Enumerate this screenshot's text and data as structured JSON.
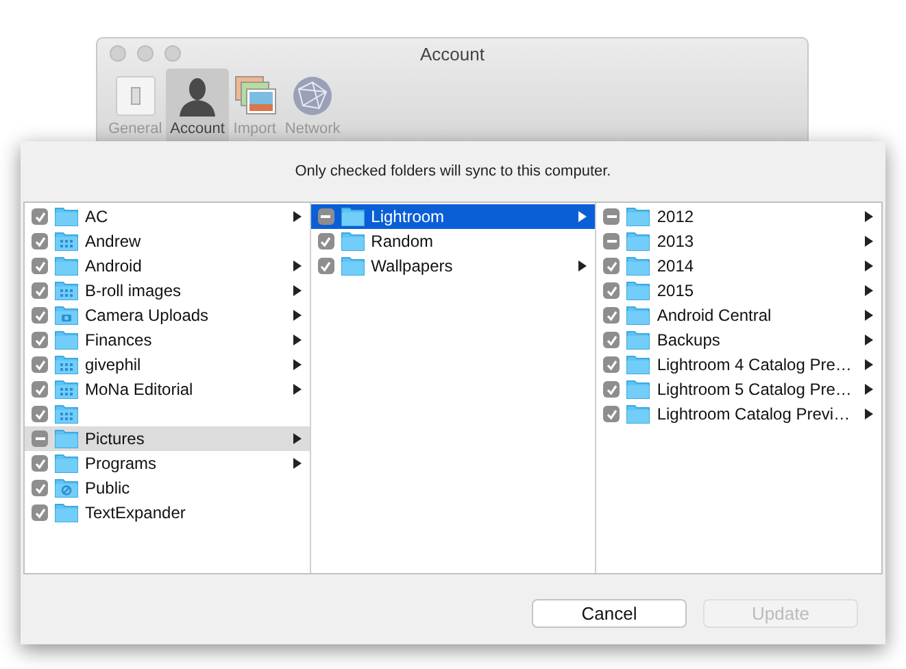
{
  "window": {
    "title": "Account"
  },
  "toolbar": [
    {
      "label": "General",
      "kind": "general",
      "selected": false
    },
    {
      "label": "Account",
      "kind": "account",
      "selected": true
    },
    {
      "label": "Import",
      "kind": "import",
      "selected": false
    },
    {
      "label": "Network",
      "kind": "network",
      "selected": false
    }
  ],
  "sheet": {
    "message": "Only checked folders will sync to this computer.",
    "columns": [
      [
        {
          "name": "AC",
          "checked": true,
          "mixed": false,
          "kind": "plain",
          "has_children": true,
          "selected": false
        },
        {
          "name": "Andrew",
          "checked": true,
          "mixed": false,
          "kind": "apps",
          "has_children": false,
          "selected": false
        },
        {
          "name": "Android",
          "checked": true,
          "mixed": false,
          "kind": "plain",
          "has_children": true,
          "selected": false
        },
        {
          "name": "B-roll images",
          "checked": true,
          "mixed": false,
          "kind": "apps",
          "has_children": true,
          "selected": false
        },
        {
          "name": "Camera Uploads",
          "checked": true,
          "mixed": false,
          "kind": "camera",
          "has_children": true,
          "selected": false
        },
        {
          "name": "Finances",
          "checked": true,
          "mixed": false,
          "kind": "plain",
          "has_children": true,
          "selected": false
        },
        {
          "name": "givephil",
          "checked": true,
          "mixed": false,
          "kind": "apps",
          "has_children": true,
          "selected": false
        },
        {
          "name": "MoNa Editorial",
          "checked": true,
          "mixed": false,
          "kind": "apps",
          "has_children": true,
          "selected": false
        },
        {
          "checked": true,
          "mixed": false,
          "kind": "apps",
          "has_children": false,
          "selected": false
        },
        {
          "name": "Pictures",
          "checked": true,
          "mixed": true,
          "kind": "plain",
          "has_children": true,
          "selected": true
        },
        {
          "name": "Programs",
          "checked": true,
          "mixed": false,
          "kind": "plain",
          "has_children": true,
          "selected": false
        },
        {
          "name": "Public",
          "checked": true,
          "mixed": false,
          "kind": "public",
          "has_children": false,
          "selected": false
        },
        {
          "name": "TextExpander",
          "checked": true,
          "mixed": false,
          "kind": "plain",
          "has_children": false,
          "selected": false
        }
      ],
      [
        {
          "name": "Lightroom",
          "checked": true,
          "mixed": true,
          "kind": "plain",
          "has_children": true,
          "selected": true
        },
        {
          "name": "Random",
          "checked": true,
          "mixed": false,
          "kind": "plain",
          "has_children": false,
          "selected": false
        },
        {
          "name": "Wallpapers",
          "checked": true,
          "mixed": false,
          "kind": "plain",
          "has_children": true,
          "selected": false
        }
      ],
      [
        {
          "name": "2012",
          "checked": true,
          "mixed": true,
          "kind": "plain",
          "has_children": true,
          "selected": false
        },
        {
          "name": "2013",
          "checked": true,
          "mixed": true,
          "kind": "plain",
          "has_children": true,
          "selected": false
        },
        {
          "name": "2014",
          "checked": true,
          "mixed": false,
          "kind": "plain",
          "has_children": true,
          "selected": false
        },
        {
          "name": "2015",
          "checked": true,
          "mixed": false,
          "kind": "plain",
          "has_children": true,
          "selected": false
        },
        {
          "name": "Android Central",
          "checked": true,
          "mixed": false,
          "kind": "plain",
          "has_children": true,
          "selected": false
        },
        {
          "name": "Backups",
          "checked": true,
          "mixed": false,
          "kind": "plain",
          "has_children": true,
          "selected": false
        },
        {
          "name": "Lightroom 4 Catalog Pre…",
          "checked": true,
          "mixed": false,
          "kind": "plain",
          "has_children": true,
          "selected": false
        },
        {
          "name": "Lightroom 5 Catalog Pre…",
          "checked": true,
          "mixed": false,
          "kind": "plain",
          "has_children": true,
          "selected": false
        },
        {
          "name": "Lightroom Catalog Previ…",
          "checked": true,
          "mixed": false,
          "kind": "plain",
          "has_children": true,
          "selected": false
        }
      ]
    ],
    "buttons": [
      {
        "label": "Cancel",
        "disabled": false
      },
      {
        "label": "Update",
        "disabled": true
      }
    ]
  }
}
